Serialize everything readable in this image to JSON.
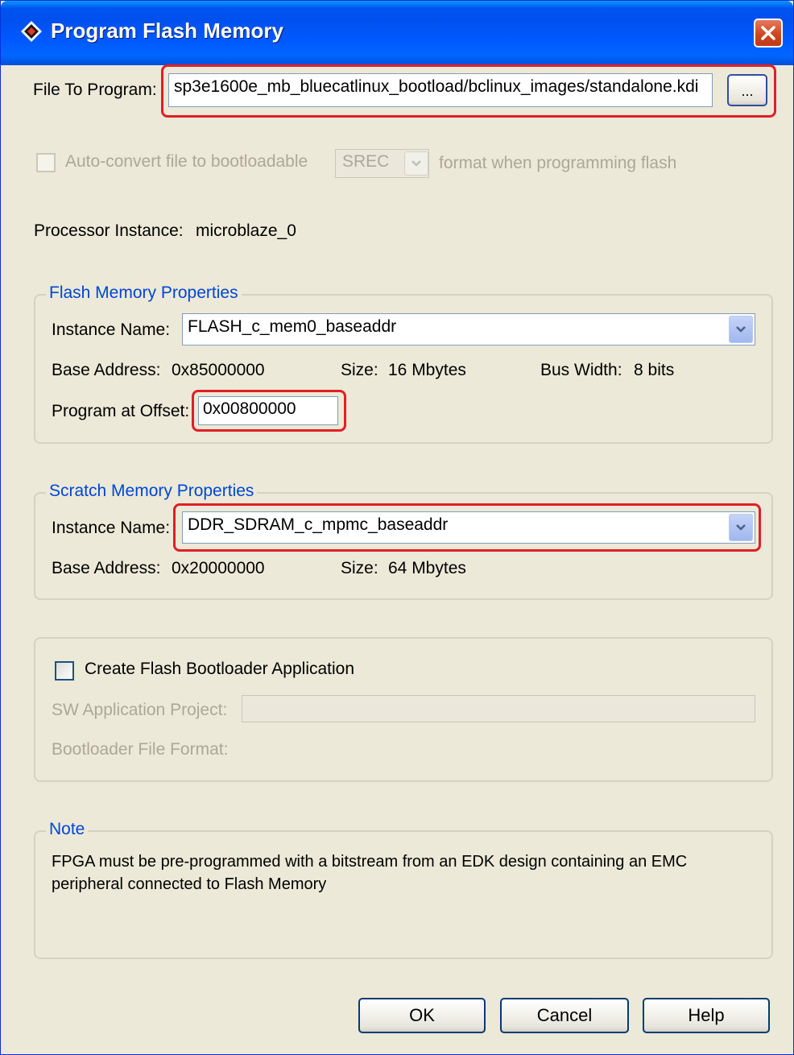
{
  "window": {
    "title": "Program Flash Memory"
  },
  "file_to_program": {
    "label": "File To Program:",
    "value": "sp3e1600e_mb_bluecatlinux_bootload/bclinux_images/standalone.kdi",
    "browse_label": "..."
  },
  "auto_convert": {
    "checkbox_label": "Auto-convert file to bootloadable",
    "format_value": "SREC",
    "suffix": "format when programming flash",
    "checked": false
  },
  "processor": {
    "label": "Processor Instance:",
    "value": "microblaze_0"
  },
  "flash_props": {
    "title": "Flash Memory Properties",
    "instance_label": "Instance Name:",
    "instance_value": "FLASH_c_mem0_baseaddr",
    "base_address_label": "Base Address:",
    "base_address_value": "0x85000000",
    "size_label": "Size:",
    "size_value": "16 Mbytes",
    "bus_width_label": "Bus Width:",
    "bus_width_value": "8 bits",
    "offset_label": "Program at Offset:",
    "offset_value": "0x00800000"
  },
  "scratch_props": {
    "title": "Scratch Memory Properties",
    "instance_label": "Instance Name:",
    "instance_value": "DDR_SDRAM_c_mpmc_baseaddr",
    "base_address_label": "Base Address:",
    "base_address_value": "0x20000000",
    "size_label": "Size:",
    "size_value": "64 Mbytes"
  },
  "bootloader": {
    "checkbox_label": "Create Flash Bootloader Application",
    "checked": false,
    "sw_project_label": "SW Application Project:",
    "sw_project_value": "",
    "file_format_label": "Bootloader File Format:"
  },
  "note": {
    "title": "Note",
    "line1": "FPGA must be pre-programmed with a bitstream from an EDK design containing an EMC",
    "line2": "peripheral connected to Flash Memory"
  },
  "buttons": {
    "ok": "OK",
    "cancel": "Cancel",
    "help": "Help"
  },
  "colors": {
    "titlebar": "#0058ff",
    "dialog_bg": "#ece9d8",
    "highlight_frame": "#e01f25",
    "group_title": "#0046d5"
  }
}
